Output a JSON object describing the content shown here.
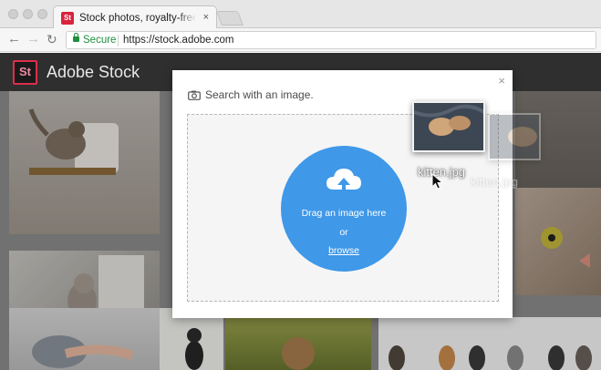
{
  "browser": {
    "tab_title": "Stock photos, royalty-free images",
    "tab_favicon": "St",
    "tab_close_icon": "×",
    "secure_label": "Secure",
    "url": "https://stock.adobe.com"
  },
  "header": {
    "logo": "St",
    "brand": "Adobe Stock"
  },
  "modal": {
    "title": "Search with an image.",
    "close_icon": "×",
    "drop_text": "Drag an image here",
    "or_text": "or",
    "browse_label": "browse",
    "accent_color": "#3f98e8"
  },
  "drag": {
    "file_name": "kitten.jpg"
  },
  "colors": {
    "brand_red": "#dd2f4b",
    "header_bg": "#2f2f2f",
    "secure_green": "#1e8e3e"
  }
}
